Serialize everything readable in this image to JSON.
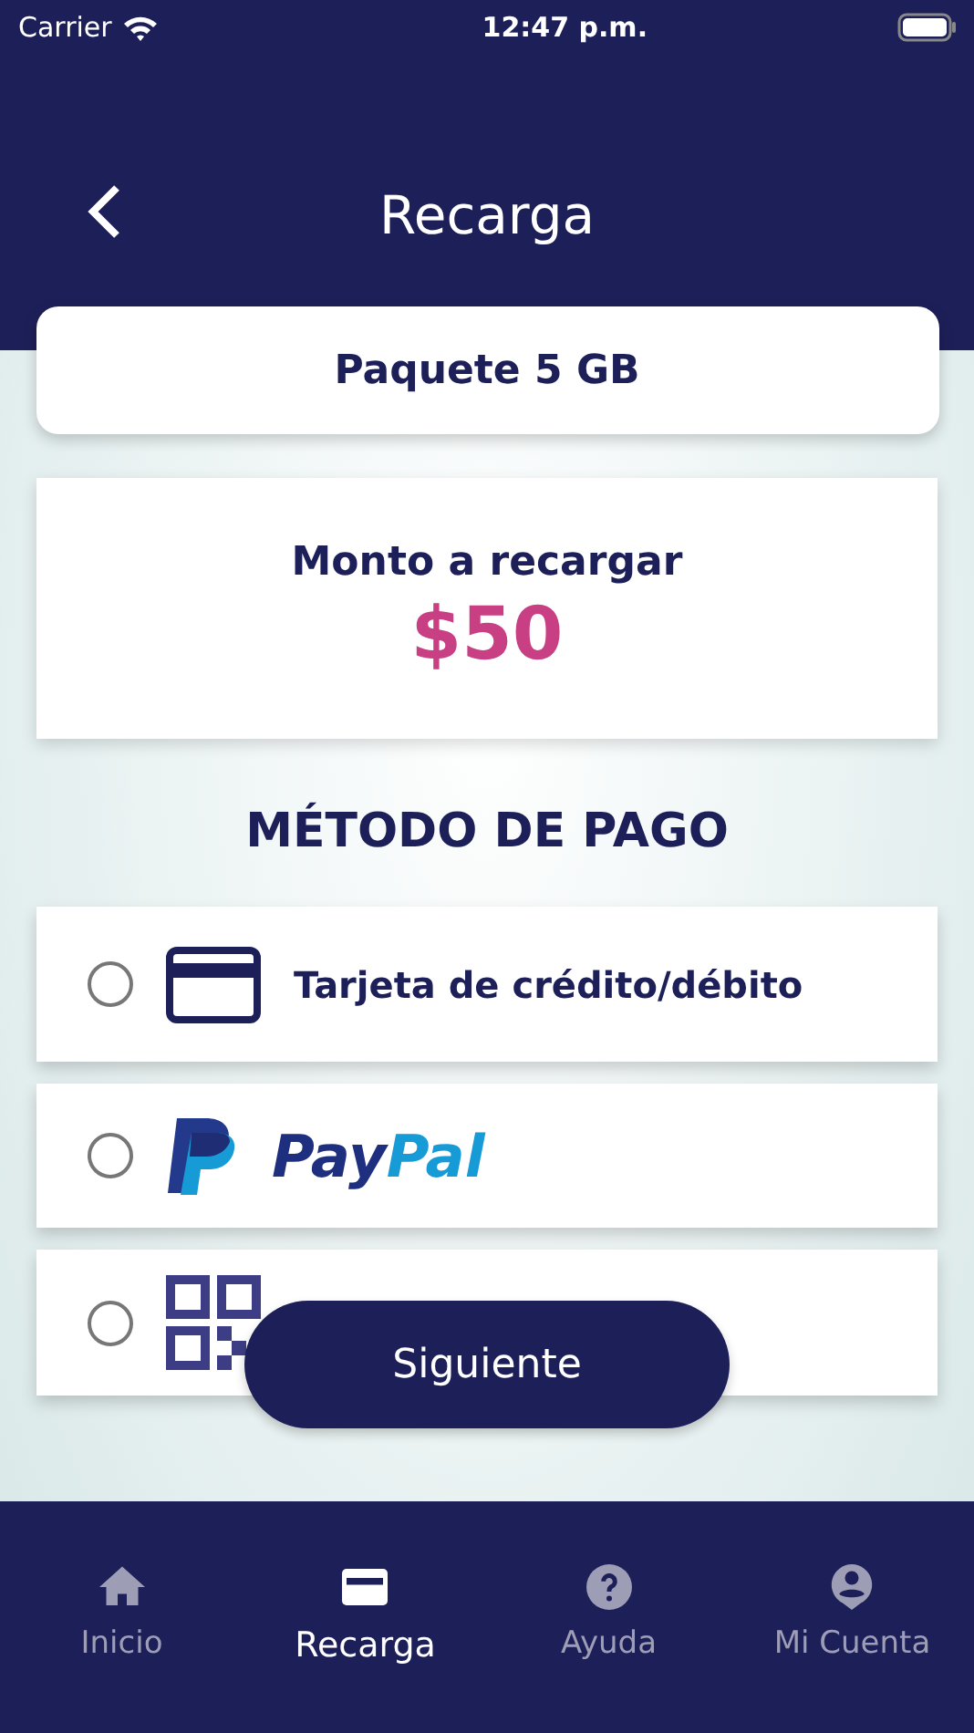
{
  "status_bar": {
    "carrier": "Carrier",
    "time": "12:47 p.m."
  },
  "header": {
    "title": "Recarga"
  },
  "package": {
    "label": "Paquete 5 GB"
  },
  "amount": {
    "label": "Monto a recargar",
    "value": "$50"
  },
  "payment": {
    "heading": "MÉTODO DE PAGO",
    "options": [
      {
        "kind": "card",
        "label": "Tarjeta de crédito/débito",
        "selected": false
      },
      {
        "kind": "paypal",
        "logo_parts": [
          "Pay",
          "Pal"
        ],
        "selected": false
      },
      {
        "kind": "qr",
        "selected": false
      }
    ]
  },
  "next_button": {
    "label": "Siguiente"
  },
  "tab_bar": [
    {
      "kind": "home",
      "label": "Inicio",
      "selected": false
    },
    {
      "kind": "card",
      "label": "Recarga",
      "selected": true
    },
    {
      "kind": "help",
      "label": "Ayuda",
      "selected": false
    },
    {
      "kind": "account",
      "label": "Mi Cuenta",
      "selected": false
    }
  ]
}
